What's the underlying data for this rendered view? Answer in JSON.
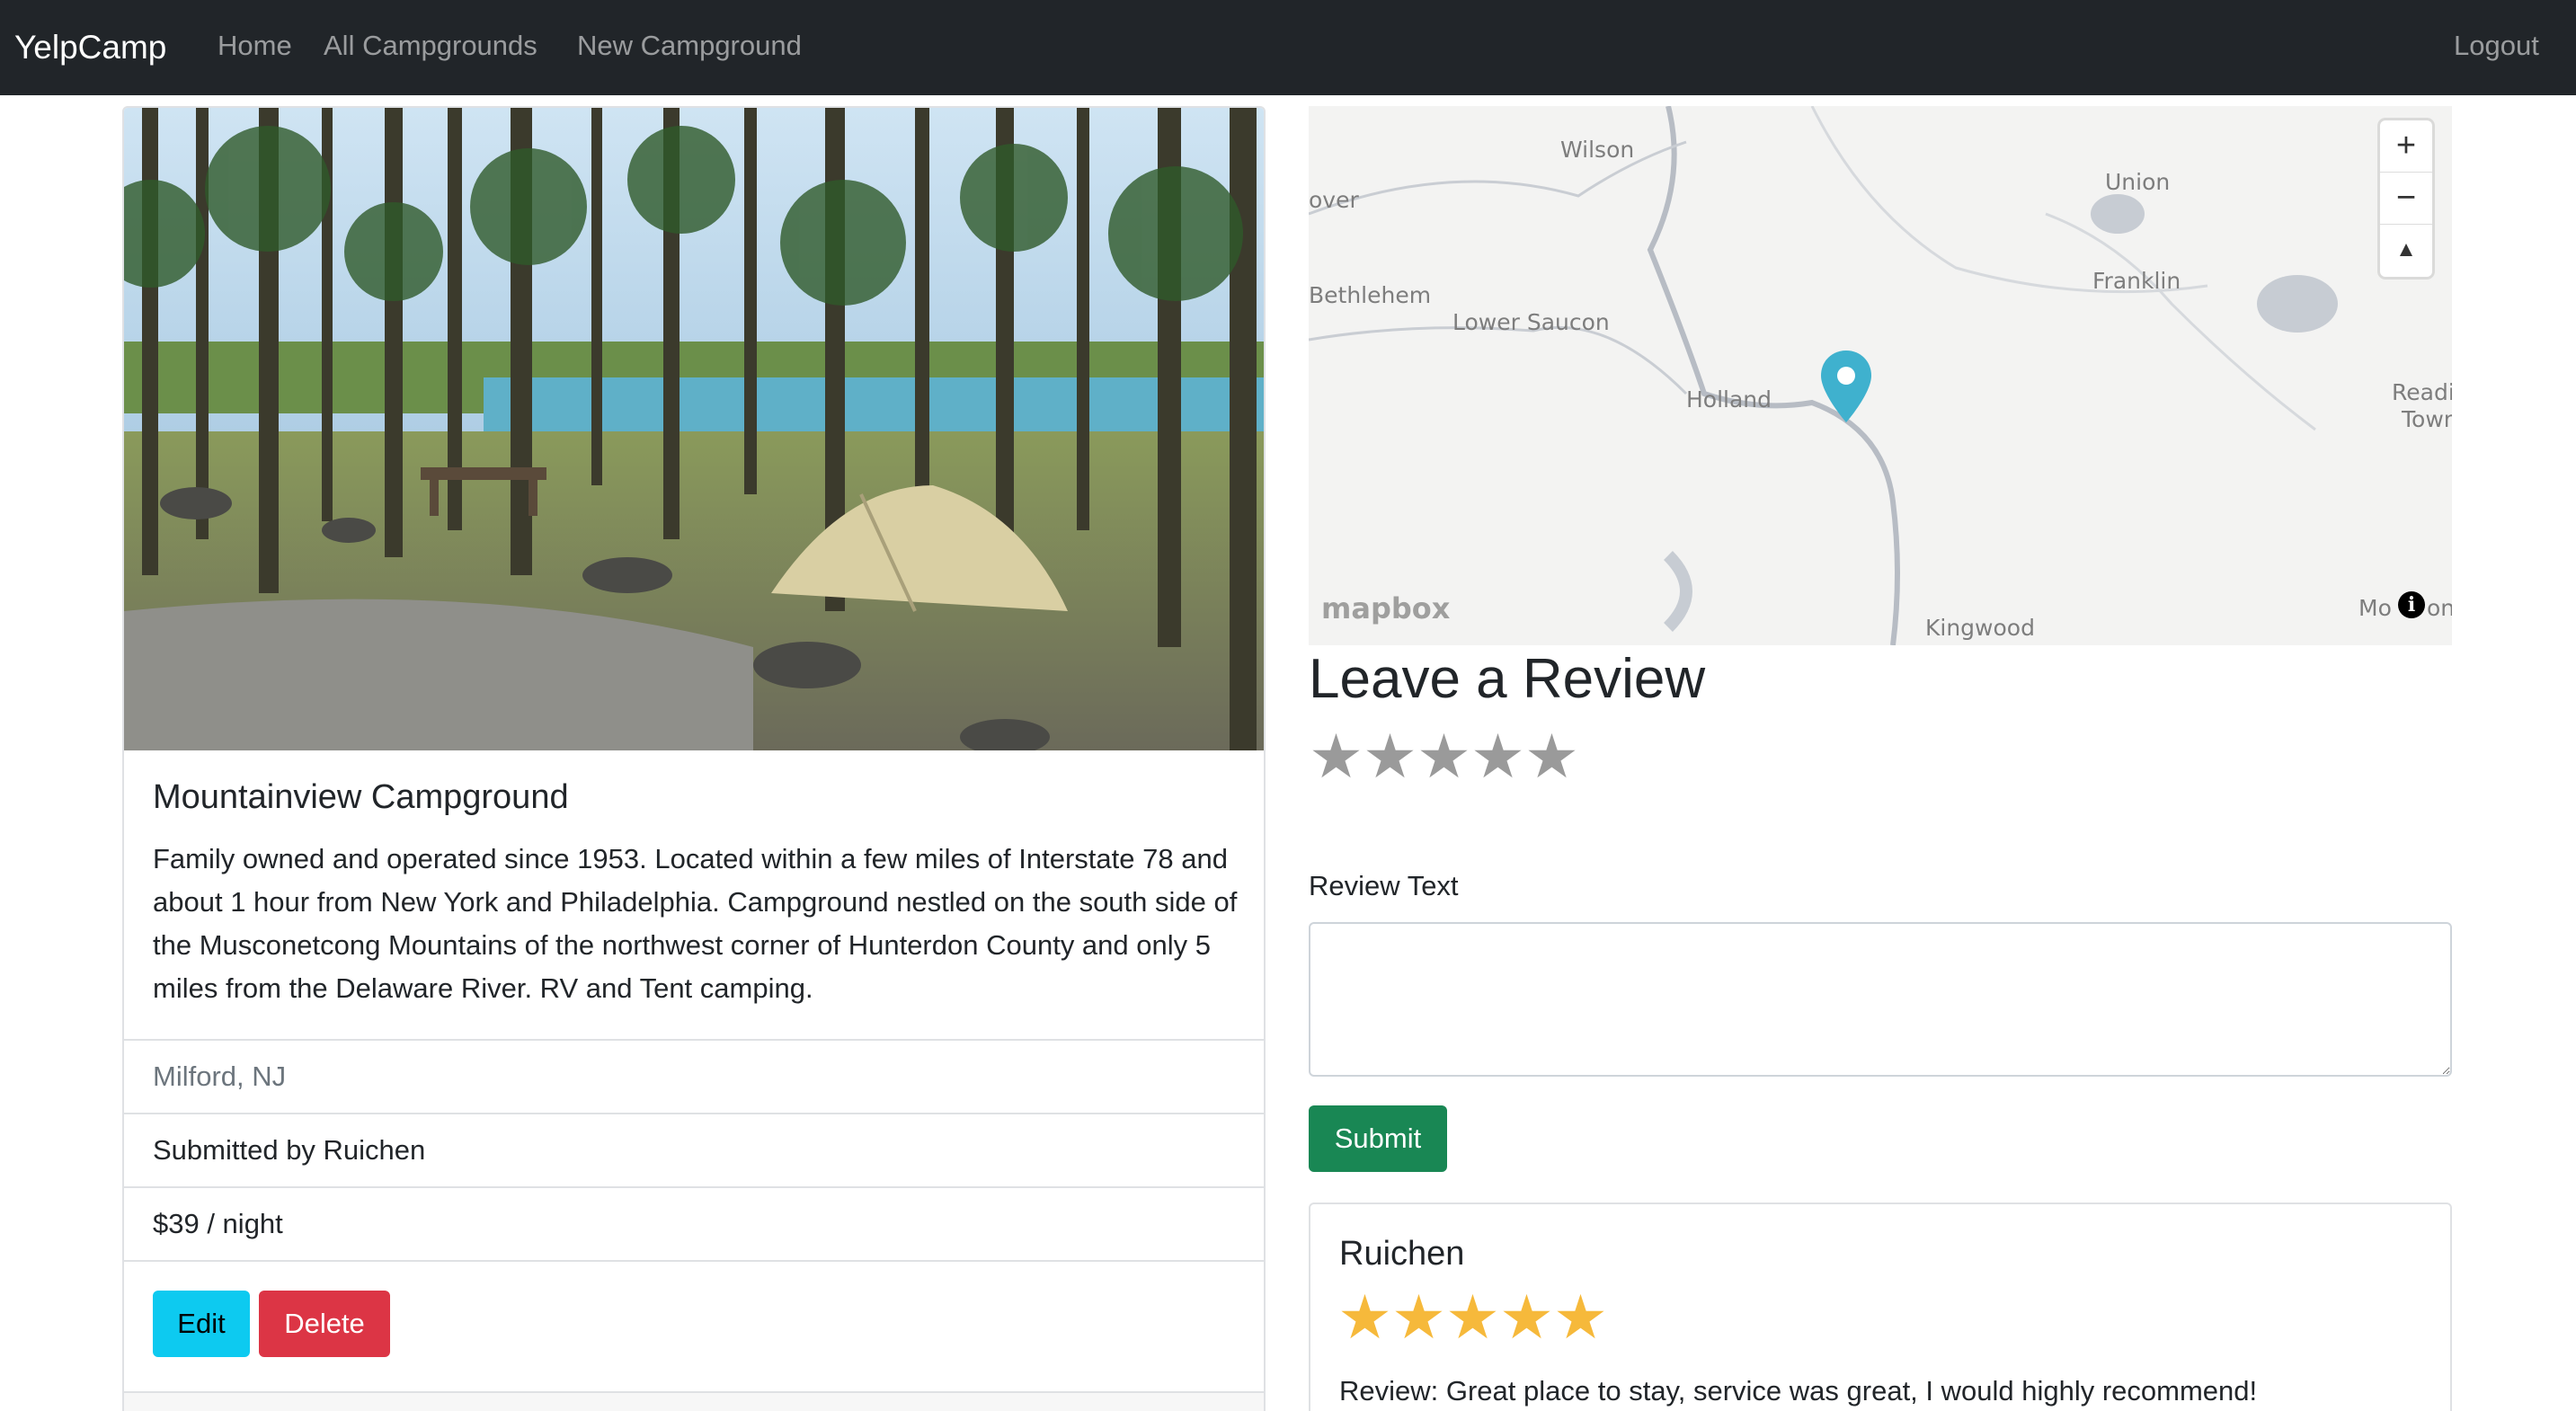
{
  "navbar": {
    "brand": "YelpCamp",
    "links": [
      "Home",
      "All Campgrounds",
      "New Campground"
    ],
    "logout": "Logout"
  },
  "campground": {
    "title": "Mountainview Campground",
    "description": "Family owned and operated since 1953. Located within a few miles of Interstate 78 and about 1 hour from New York and Philadelphia. Campground nestled on the south side of the Musconetcong Mountains of the northwest corner of Hunterdon County and only 5 miles from the Delaware River. RV and Tent camping.",
    "location": "Milford, NJ",
    "submitted_by": "Submitted by Ruichen",
    "price": "$39 / night",
    "edit_label": "Edit",
    "delete_label": "Delete"
  },
  "map": {
    "labels": [
      "Wilson",
      "over",
      "Union",
      "Franklin",
      "Bethlehem",
      "Lower Saucon",
      "Holland",
      "Readi",
      "Town",
      "Kingwood",
      "Mo",
      "on"
    ],
    "zoom_in": "+",
    "zoom_out": "−",
    "compass": "▲",
    "attribution": "mapbox",
    "info": "i"
  },
  "review_form": {
    "heading": "Leave a Review",
    "rating_stars": 5,
    "text_label": "Review Text",
    "text_value": "",
    "submit_label": "Submit"
  },
  "reviews": [
    {
      "user": "Ruichen",
      "rating": 5,
      "text": "Review: Great place to stay, service was great, I would highly recommend!"
    }
  ],
  "colors": {
    "navbar": "#212529",
    "edit": "#0dcaf0",
    "delete": "#dc3545",
    "submit": "#198754",
    "star_filled": "#f6b93b",
    "star_empty": "#9a9a9a",
    "map_pin": "#3fb1ce"
  }
}
